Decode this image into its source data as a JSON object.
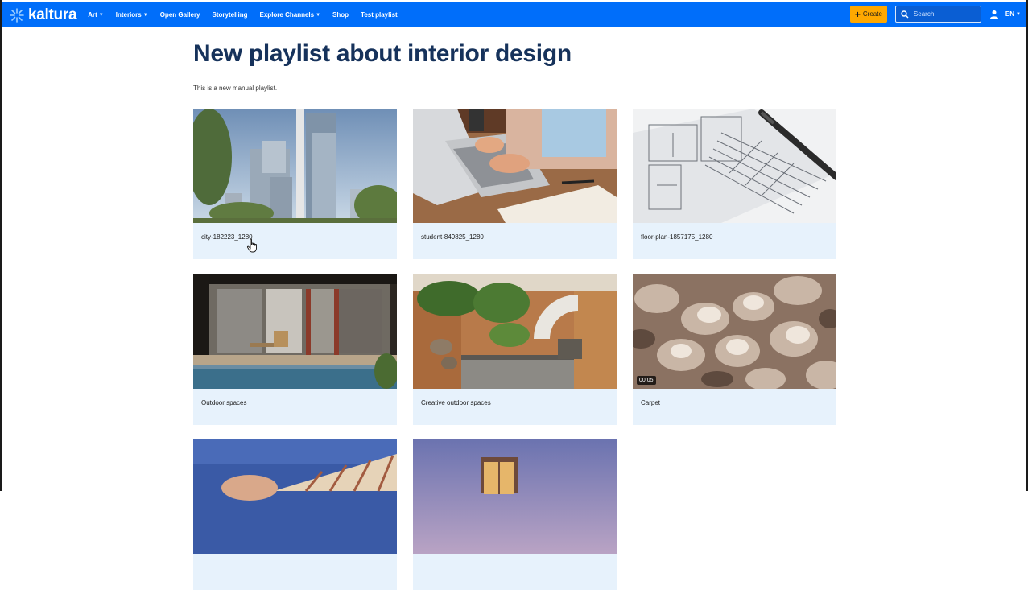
{
  "header": {
    "logo_text": "kaltura",
    "nav": [
      {
        "label": "Art",
        "dropdown": true
      },
      {
        "label": "Interiors",
        "dropdown": true
      },
      {
        "label": "Open Gallery",
        "dropdown": false
      },
      {
        "label": "Storytelling",
        "dropdown": false
      },
      {
        "label": "Explore Channels",
        "dropdown": true
      },
      {
        "label": "Shop",
        "dropdown": false
      },
      {
        "label": "Test playlist",
        "dropdown": false
      }
    ],
    "create_label": "Create",
    "search_placeholder": "Search",
    "language": "EN"
  },
  "page": {
    "title": "New playlist about interior design",
    "description": "This is a new manual playlist."
  },
  "cards": [
    {
      "title": "city-182223_1280"
    },
    {
      "title": "student-849825_1280"
    },
    {
      "title": "floor-plan-1857175_1280"
    },
    {
      "title": "Outdoor spaces"
    },
    {
      "title": "Creative outdoor spaces"
    },
    {
      "title": "Carpet",
      "duration": "00:05"
    },
    {
      "title": ""
    },
    {
      "title": ""
    }
  ],
  "colors": {
    "topbar": "#006efa",
    "create_button": "#ffa800",
    "title": "#16325b",
    "card_bg": "#e7f2fc"
  }
}
